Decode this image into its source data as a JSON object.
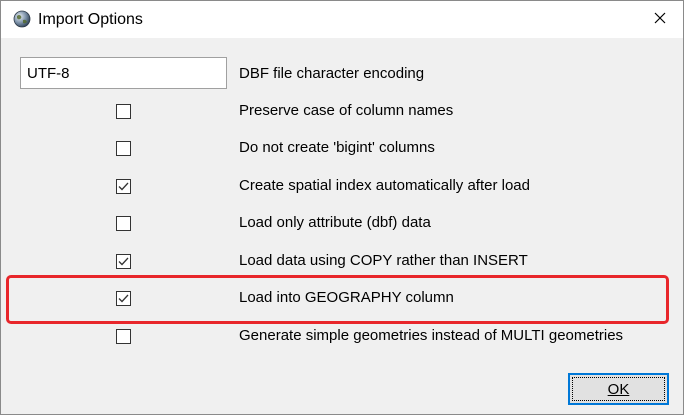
{
  "window": {
    "title": "Import Options",
    "app_icon": "globe-icon",
    "close_icon": "close-icon"
  },
  "encoding": {
    "value": "UTF-8",
    "label": "DBF file character encoding"
  },
  "options": [
    {
      "label": "Preserve case of column names",
      "checked": false
    },
    {
      "label": "Do not create 'bigint' columns",
      "checked": false
    },
    {
      "label": "Create spatial index automatically after load",
      "checked": true
    },
    {
      "label": "Load only attribute (dbf) data",
      "checked": false
    },
    {
      "label": "Load data using COPY rather than INSERT",
      "checked": true
    },
    {
      "label": "Load into GEOGRAPHY column",
      "checked": true
    },
    {
      "label": "Generate simple geometries instead of MULTI geometries",
      "checked": false
    }
  ],
  "highlight_color": "#e8262b",
  "ok_button": {
    "label": "OK"
  }
}
